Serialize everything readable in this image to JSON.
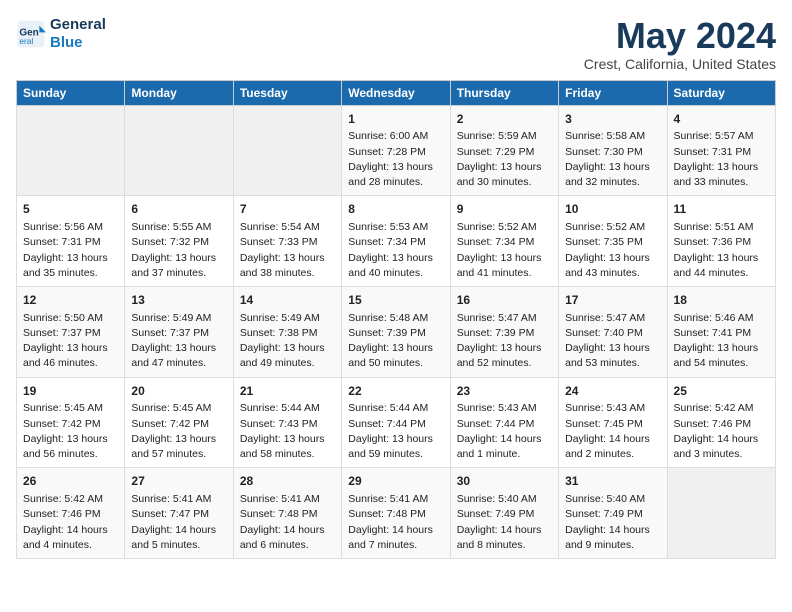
{
  "header": {
    "logo_line1": "General",
    "logo_line2": "Blue",
    "title": "May 2024",
    "subtitle": "Crest, California, United States"
  },
  "days_of_week": [
    "Sunday",
    "Monday",
    "Tuesday",
    "Wednesday",
    "Thursday",
    "Friday",
    "Saturday"
  ],
  "weeks": [
    [
      {
        "day": "",
        "info": ""
      },
      {
        "day": "",
        "info": ""
      },
      {
        "day": "",
        "info": ""
      },
      {
        "day": "1",
        "info": "Sunrise: 6:00 AM\nSunset: 7:28 PM\nDaylight: 13 hours\nand 28 minutes."
      },
      {
        "day": "2",
        "info": "Sunrise: 5:59 AM\nSunset: 7:29 PM\nDaylight: 13 hours\nand 30 minutes."
      },
      {
        "day": "3",
        "info": "Sunrise: 5:58 AM\nSunset: 7:30 PM\nDaylight: 13 hours\nand 32 minutes."
      },
      {
        "day": "4",
        "info": "Sunrise: 5:57 AM\nSunset: 7:31 PM\nDaylight: 13 hours\nand 33 minutes."
      }
    ],
    [
      {
        "day": "5",
        "info": "Sunrise: 5:56 AM\nSunset: 7:31 PM\nDaylight: 13 hours\nand 35 minutes."
      },
      {
        "day": "6",
        "info": "Sunrise: 5:55 AM\nSunset: 7:32 PM\nDaylight: 13 hours\nand 37 minutes."
      },
      {
        "day": "7",
        "info": "Sunrise: 5:54 AM\nSunset: 7:33 PM\nDaylight: 13 hours\nand 38 minutes."
      },
      {
        "day": "8",
        "info": "Sunrise: 5:53 AM\nSunset: 7:34 PM\nDaylight: 13 hours\nand 40 minutes."
      },
      {
        "day": "9",
        "info": "Sunrise: 5:52 AM\nSunset: 7:34 PM\nDaylight: 13 hours\nand 41 minutes."
      },
      {
        "day": "10",
        "info": "Sunrise: 5:52 AM\nSunset: 7:35 PM\nDaylight: 13 hours\nand 43 minutes."
      },
      {
        "day": "11",
        "info": "Sunrise: 5:51 AM\nSunset: 7:36 PM\nDaylight: 13 hours\nand 44 minutes."
      }
    ],
    [
      {
        "day": "12",
        "info": "Sunrise: 5:50 AM\nSunset: 7:37 PM\nDaylight: 13 hours\nand 46 minutes."
      },
      {
        "day": "13",
        "info": "Sunrise: 5:49 AM\nSunset: 7:37 PM\nDaylight: 13 hours\nand 47 minutes."
      },
      {
        "day": "14",
        "info": "Sunrise: 5:49 AM\nSunset: 7:38 PM\nDaylight: 13 hours\nand 49 minutes."
      },
      {
        "day": "15",
        "info": "Sunrise: 5:48 AM\nSunset: 7:39 PM\nDaylight: 13 hours\nand 50 minutes."
      },
      {
        "day": "16",
        "info": "Sunrise: 5:47 AM\nSunset: 7:39 PM\nDaylight: 13 hours\nand 52 minutes."
      },
      {
        "day": "17",
        "info": "Sunrise: 5:47 AM\nSunset: 7:40 PM\nDaylight: 13 hours\nand 53 minutes."
      },
      {
        "day": "18",
        "info": "Sunrise: 5:46 AM\nSunset: 7:41 PM\nDaylight: 13 hours\nand 54 minutes."
      }
    ],
    [
      {
        "day": "19",
        "info": "Sunrise: 5:45 AM\nSunset: 7:42 PM\nDaylight: 13 hours\nand 56 minutes."
      },
      {
        "day": "20",
        "info": "Sunrise: 5:45 AM\nSunset: 7:42 PM\nDaylight: 13 hours\nand 57 minutes."
      },
      {
        "day": "21",
        "info": "Sunrise: 5:44 AM\nSunset: 7:43 PM\nDaylight: 13 hours\nand 58 minutes."
      },
      {
        "day": "22",
        "info": "Sunrise: 5:44 AM\nSunset: 7:44 PM\nDaylight: 13 hours\nand 59 minutes."
      },
      {
        "day": "23",
        "info": "Sunrise: 5:43 AM\nSunset: 7:44 PM\nDaylight: 14 hours\nand 1 minute."
      },
      {
        "day": "24",
        "info": "Sunrise: 5:43 AM\nSunset: 7:45 PM\nDaylight: 14 hours\nand 2 minutes."
      },
      {
        "day": "25",
        "info": "Sunrise: 5:42 AM\nSunset: 7:46 PM\nDaylight: 14 hours\nand 3 minutes."
      }
    ],
    [
      {
        "day": "26",
        "info": "Sunrise: 5:42 AM\nSunset: 7:46 PM\nDaylight: 14 hours\nand 4 minutes."
      },
      {
        "day": "27",
        "info": "Sunrise: 5:41 AM\nSunset: 7:47 PM\nDaylight: 14 hours\nand 5 minutes."
      },
      {
        "day": "28",
        "info": "Sunrise: 5:41 AM\nSunset: 7:48 PM\nDaylight: 14 hours\nand 6 minutes."
      },
      {
        "day": "29",
        "info": "Sunrise: 5:41 AM\nSunset: 7:48 PM\nDaylight: 14 hours\nand 7 minutes."
      },
      {
        "day": "30",
        "info": "Sunrise: 5:40 AM\nSunset: 7:49 PM\nDaylight: 14 hours\nand 8 minutes."
      },
      {
        "day": "31",
        "info": "Sunrise: 5:40 AM\nSunset: 7:49 PM\nDaylight: 14 hours\nand 9 minutes."
      },
      {
        "day": "",
        "info": ""
      }
    ]
  ]
}
